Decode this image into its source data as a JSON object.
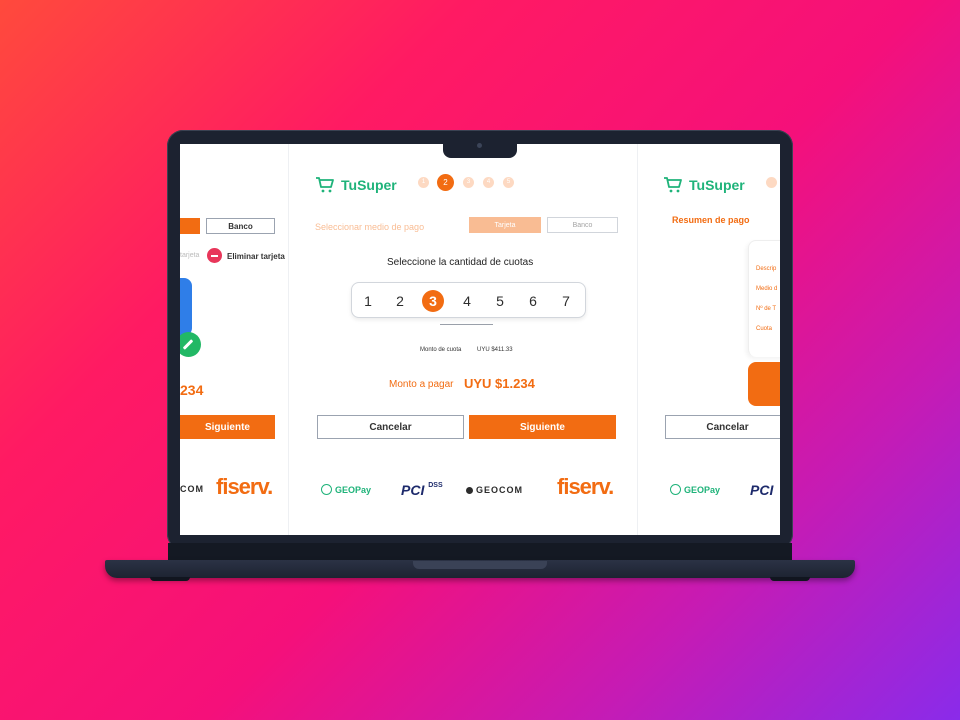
{
  "brand": {
    "name": "TuSuper",
    "accent": "#f26c12",
    "green": "#1fb37a"
  },
  "steps": {
    "labels": [
      "1",
      "2",
      "3",
      "4",
      "5"
    ],
    "active": "2"
  },
  "left_panel": {
    "bank_tab": "Banco",
    "card_label": "tarjeta",
    "delete_card": "Eliminar tarjeta",
    "amount_partial": "234",
    "next_button": "Siguiente",
    "logos": {
      "geocom_partial": "COM",
      "fiserv": "fiserv."
    }
  },
  "main_panel": {
    "section_title": "Seleccionar medio de pago",
    "tabs": {
      "card": "Tarjeta",
      "bank": "Banco"
    },
    "quota_heading": "Seleccione la cantidad de cuotas",
    "quota_options": [
      "1",
      "2",
      "3",
      "4",
      "5",
      "6",
      "7"
    ],
    "selected_quota": "3",
    "installment_label": "Monto de cuota",
    "installment_value": "UYU $411.33",
    "total_label": "Monto a pagar",
    "total_value": "UYU $1.234",
    "cancel_button": "Cancelar",
    "next_button": "Siguiente",
    "logos": {
      "geopay": "GEOPay",
      "pci": "PCI",
      "pci_sub": "DSS",
      "geocom": "GEOCOM",
      "fiserv": "fiserv."
    }
  },
  "right_panel": {
    "summary_title": "Resumen de pago",
    "summary_items": [
      "Descrip",
      "Medio d",
      "Nº de T",
      "Cuota"
    ],
    "cancel_button": "Cancelar",
    "logos": {
      "geopay": "GEOPay",
      "pci": "PCI"
    }
  }
}
